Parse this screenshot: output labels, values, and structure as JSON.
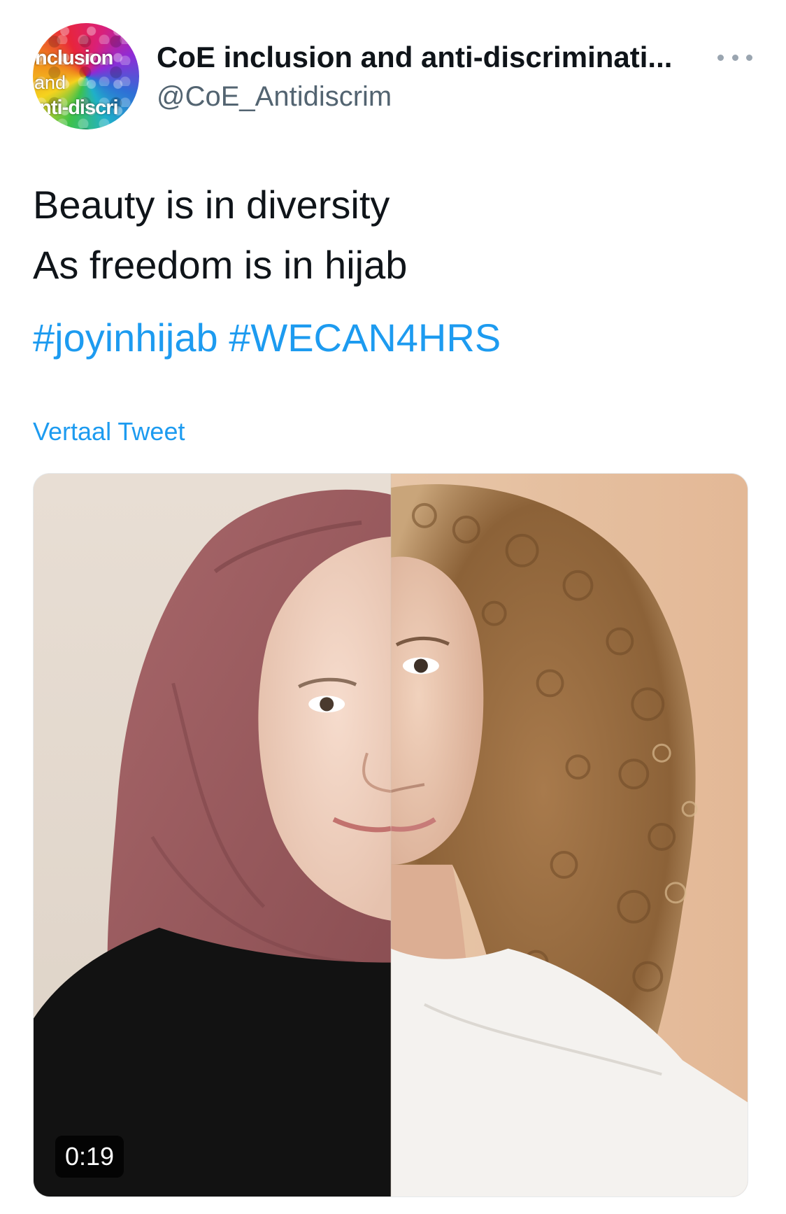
{
  "account": {
    "avatar_logo_text": [
      "inclusion",
      "and",
      "anti-discri"
    ],
    "display_name": "CoE inclusion and anti-discriminati...",
    "handle": "@CoE_Antidiscrim"
  },
  "tweet": {
    "lines": [
      "Beauty is in diversity",
      "As freedom is in hijab"
    ],
    "hashtags": [
      "#joyinhijab",
      "#WECAN4HRS"
    ],
    "translate_label": "Vertaal Tweet"
  },
  "media": {
    "type": "video",
    "duration": "0:19"
  },
  "colors": {
    "link": "#1d9bf0",
    "text": "#0f1419",
    "secondary": "#536471"
  },
  "icons": {
    "more": "more-horizontal-icon"
  }
}
